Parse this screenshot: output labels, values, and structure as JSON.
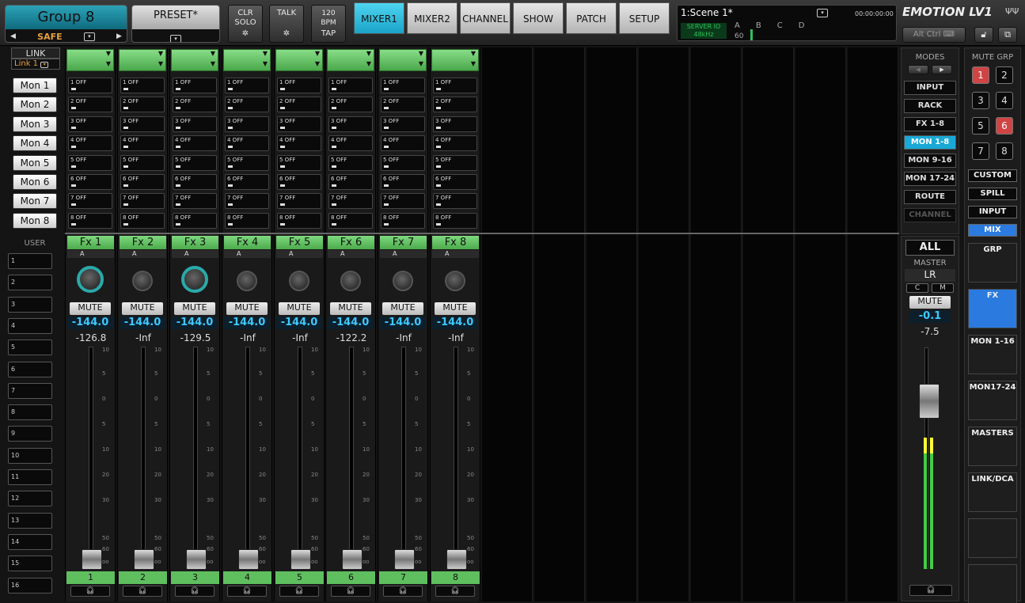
{
  "top": {
    "group_title": "Group 8",
    "safe_label": "SAFE",
    "preset_label": "PRESET*",
    "clr_solo_label": "CLR SOLO",
    "talk_label": "TALK",
    "bpm_value": "120",
    "bpm_label": "BPM",
    "tap_label": "TAP",
    "tabs": [
      "MIXER1",
      "MIXER2",
      "CHANNEL",
      "SHOW",
      "PATCH",
      "SETUP"
    ],
    "active_tab": "MIXER1",
    "scene_name": "1:Scene 1*",
    "time": "00:00:00:00",
    "server_label": "SERVER IO",
    "sample_rate": "48kHz",
    "server_letters": [
      "A",
      "B",
      "C",
      "D"
    ],
    "server_count": "60",
    "logo": "EMOTION LV1",
    "alt_label": "Alt",
    "ctrl_label": "Ctrl"
  },
  "link": {
    "label": "LINK",
    "value": "Link 1"
  },
  "mon_rows": [
    "Mon 1",
    "Mon 2",
    "Mon 3",
    "Mon 4",
    "Mon 5",
    "Mon 6",
    "Mon 7",
    "Mon 8"
  ],
  "send_labels": [
    "1 OFF",
    "2 OFF",
    "3 OFF",
    "4 OFF",
    "5 OFF",
    "6 OFF",
    "7 OFF",
    "8 OFF"
  ],
  "user_label": "USER",
  "user_buttons": [
    "1",
    "2",
    "3",
    "4",
    "5",
    "6",
    "7",
    "8",
    "9",
    "10",
    "11",
    "12",
    "13",
    "14",
    "15",
    "16"
  ],
  "channels": [
    {
      "name": "Fx 1",
      "sub": "A",
      "mute": "MUTE",
      "gain": "-144.0",
      "meter": "-126.8",
      "num": "1"
    },
    {
      "name": "Fx 2",
      "sub": "A",
      "mute": "MUTE",
      "gain": "-144.0",
      "meter": "-Inf",
      "num": "2"
    },
    {
      "name": "Fx 3",
      "sub": "A",
      "mute": "MUTE",
      "gain": "-144.0",
      "meter": "-129.5",
      "num": "3"
    },
    {
      "name": "Fx 4",
      "sub": "A",
      "mute": "MUTE",
      "gain": "-144.0",
      "meter": "-Inf",
      "num": "4"
    },
    {
      "name": "Fx 5",
      "sub": "A",
      "mute": "MUTE",
      "gain": "-144.0",
      "meter": "-Inf",
      "num": "5"
    },
    {
      "name": "Fx 6",
      "sub": "A",
      "mute": "MUTE",
      "gain": "-144.0",
      "meter": "-122.2",
      "num": "6"
    },
    {
      "name": "Fx 7",
      "sub": "A",
      "mute": "MUTE",
      "gain": "-144.0",
      "meter": "-Inf",
      "num": "7"
    },
    {
      "name": "Fx 8",
      "sub": "A",
      "mute": "MUTE",
      "gain": "-144.0",
      "meter": "-Inf",
      "num": "8"
    }
  ],
  "scale_marks": [
    "10",
    "5",
    "0",
    "5",
    "10",
    "20",
    "30",
    "50",
    "60",
    "oo"
  ],
  "modes": {
    "title": "MODES",
    "items": [
      "INPUT",
      "RACK",
      "FX 1-8",
      "MON 1-8",
      "MON 9-16",
      "MON 17-24",
      "ROUTE",
      "CHANNEL"
    ],
    "active": "MON 1-8"
  },
  "master": {
    "all": "ALL",
    "label": "MASTER",
    "name": "LR",
    "c": "C",
    "m": "M",
    "mute": "MUTE",
    "gain": "-0.1",
    "meter": "-7.5"
  },
  "mute_grp": {
    "title": "MUTE GRP",
    "items": [
      "1",
      "2",
      "3",
      "4",
      "5",
      "6",
      "7",
      "8"
    ],
    "red": [
      "1",
      "6"
    ]
  },
  "right_buttons": [
    "CUSTOM",
    "SPILL",
    "INPUT",
    "MIX"
  ],
  "group_tiles": [
    "GRP",
    "FX",
    "MON 1-16",
    "MON17-24",
    "MASTERS",
    "LINK/DCA"
  ],
  "colors": {
    "accent": "#1aa4c8",
    "green": "#5fbf5f",
    "active_blue": "#2a7ae0",
    "red": "#d04444"
  }
}
